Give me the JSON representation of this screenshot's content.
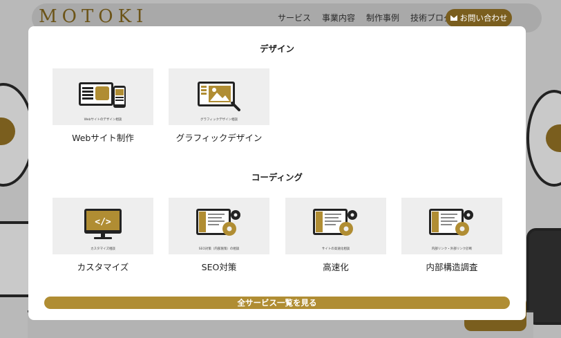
{
  "header": {
    "logo": "MOTOKI",
    "nav": [
      "サービス",
      "事業内容",
      "制作事例",
      "技術ブログ"
    ],
    "contact_label": "お問い合わせ"
  },
  "modal": {
    "sections": [
      {
        "title": "デザイン",
        "cards": [
          {
            "caption": "Webサイトのデザイン相談",
            "label": "Webサイト制作",
            "icon": "web-design-illustration"
          },
          {
            "caption": "グラフィックデザイン相談",
            "label": "グラフィックデザイン",
            "icon": "graphic-design-illustration"
          }
        ]
      },
      {
        "title": "コーディング",
        "cards": [
          {
            "caption": "カスタマイズ相談",
            "label": "カスタマイズ",
            "icon": "code-monitor-illustration"
          },
          {
            "caption": "SEO対策（内部施策）の相談",
            "label": "SEO対策",
            "icon": "seo-gear-illustration"
          },
          {
            "caption": "サイトの高速化相談",
            "label": "高速化",
            "icon": "speed-gear-illustration"
          },
          {
            "caption": "内部リンク・外部リンク診断",
            "label": "内部構造調査",
            "icon": "link-gear-illustration"
          }
        ]
      }
    ],
    "all_services_label": "全サービス一覧を見る"
  },
  "colors": {
    "brand_gold": "#b08d33",
    "dark_gold": "#7a5e1e"
  }
}
